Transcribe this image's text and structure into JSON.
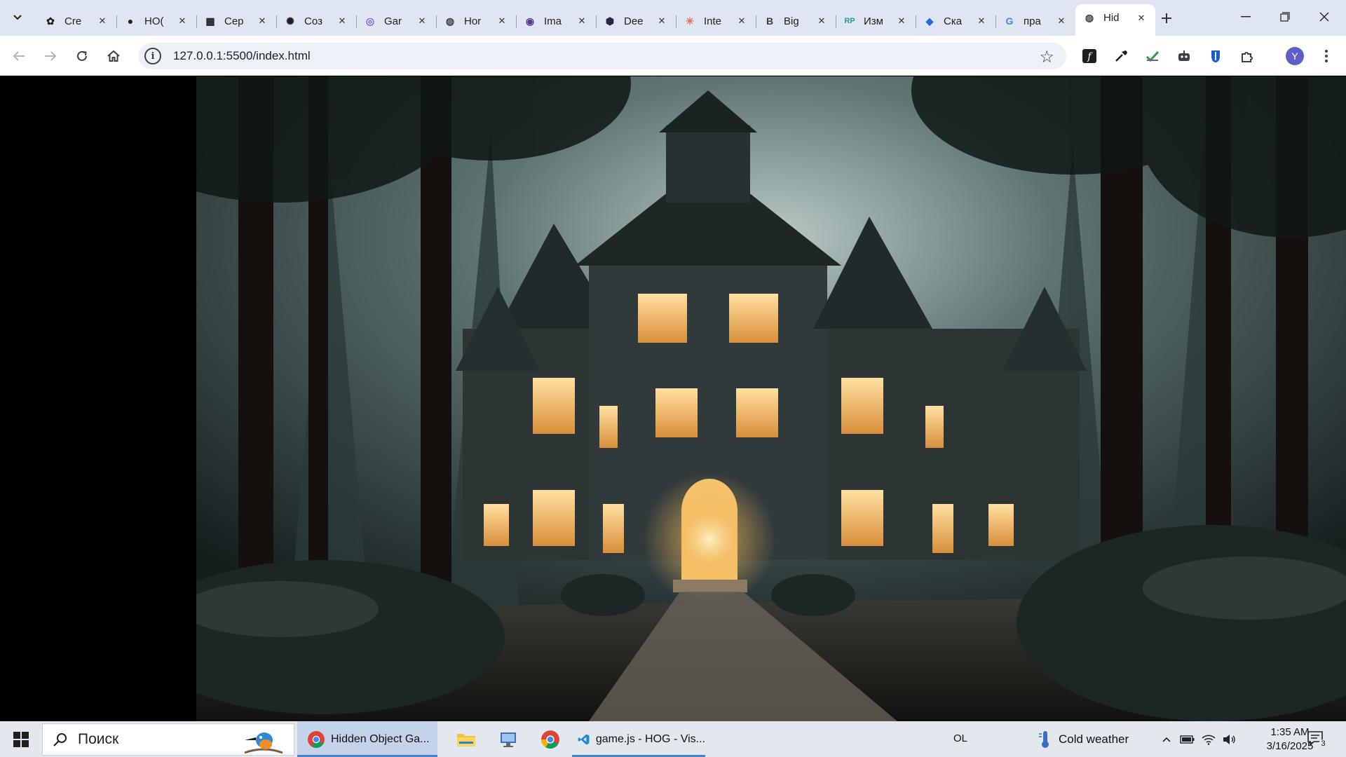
{
  "browser": {
    "tabs": [
      {
        "label": "Cre",
        "icon": "copilot-icon"
      },
      {
        "label": "HO(",
        "icon": "github-icon"
      },
      {
        "label": "Сер",
        "icon": "clapper-icon"
      },
      {
        "label": "Coз",
        "icon": "openai-icon"
      },
      {
        "label": "Gar",
        "icon": "spiral-icon"
      },
      {
        "label": "Hor",
        "icon": "globe-icon"
      },
      {
        "label": "Ima",
        "icon": "avatar-icon"
      },
      {
        "label": "Dee",
        "icon": "deepseek-icon"
      },
      {
        "label": "Inte",
        "icon": "claude-icon"
      },
      {
        "label": "Big",
        "icon": "bing-icon"
      },
      {
        "label": "Изм",
        "icon": "rp-icon"
      },
      {
        "label": "Ска",
        "icon": "bird-icon"
      },
      {
        "label": "пра",
        "icon": "google-icon"
      },
      {
        "label": "Hid",
        "icon": "globe-icon",
        "active": true
      }
    ],
    "url": "127.0.0.1:5500/index.html",
    "profile_initial": "Y"
  },
  "taskbar": {
    "search_placeholder": "Поиск",
    "apps": [
      {
        "label": "Hidden Object Ga...",
        "icon": "chrome-icon"
      },
      {
        "label": "",
        "icon": "file-explorer-icon"
      },
      {
        "label": "",
        "icon": "network-app-icon"
      },
      {
        "label": "",
        "icon": "chrome-icon"
      },
      {
        "label": "game.js - HOG - Vis...",
        "icon": "vscode-icon"
      }
    ],
    "ime": "OL",
    "weather": "Cold weather",
    "time": "1:35 AM",
    "date": "3/16/2025",
    "notification_count": "3"
  },
  "colors": {
    "tabstrip": "#dfe5f1",
    "taskbar": "#e3e8ef",
    "accent": "#3c86d8"
  }
}
